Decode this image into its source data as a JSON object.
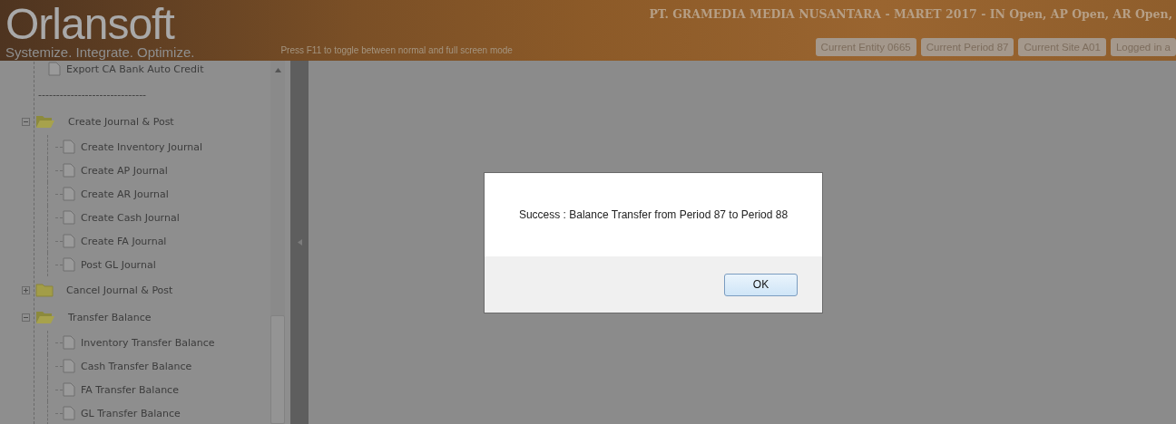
{
  "header": {
    "logo": "Orlansoft",
    "tagline": "Systemize. Integrate. Optimize.",
    "hint": "Press F11 to toggle between normal and full screen mode",
    "company": "PT. GRAMEDIA MEDIA NUSANTARA - MARET 2017 - IN Open, AP Open, AR Open,",
    "badges": [
      "Current Entity 0665",
      "Current Period 87",
      "Current Site A01",
      "Logged in a"
    ]
  },
  "tree": [
    {
      "kind": "leaf",
      "label": "Export CA Bank Auto Credit"
    },
    {
      "kind": "separator",
      "label": "------------------------------"
    },
    {
      "kind": "folder",
      "label": "Create Journal & Post",
      "expanded": true,
      "children": [
        {
          "kind": "leaf",
          "label": "Create Inventory Journal"
        },
        {
          "kind": "leaf",
          "label": "Create AP Journal"
        },
        {
          "kind": "leaf",
          "label": "Create AR Journal"
        },
        {
          "kind": "leaf",
          "label": "Create Cash Journal"
        },
        {
          "kind": "leaf",
          "label": "Create FA Journal"
        },
        {
          "kind": "leaf",
          "label": "Post GL Journal"
        }
      ]
    },
    {
      "kind": "folder",
      "label": "Cancel Journal & Post",
      "expanded": false
    },
    {
      "kind": "folder",
      "label": "Transfer Balance",
      "expanded": true,
      "children": [
        {
          "kind": "leaf",
          "label": "Inventory Transfer Balance"
        },
        {
          "kind": "leaf",
          "label": "Cash Transfer Balance"
        },
        {
          "kind": "leaf",
          "label": "FA Transfer Balance"
        },
        {
          "kind": "leaf",
          "label": "GL Transfer Balance"
        }
      ]
    }
  ],
  "dialog": {
    "message": "Success : Balance Transfer from Period 87 to Period 88",
    "buttons": [
      "OK"
    ]
  }
}
